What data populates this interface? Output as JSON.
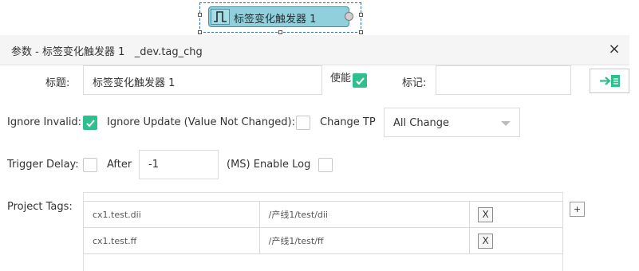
{
  "node": {
    "label": "标签变化触发器 1",
    "icon": "pulse-wave-icon"
  },
  "dialog": {
    "title": "参数 - 标签变化触发器 1   _dev.tag_chg",
    "close_icon": "×"
  },
  "form": {
    "title_label": "标题:",
    "title_value": "标签变化触发器 1",
    "enable_label": "使能",
    "enable_checked": true,
    "mark_label": "标记:",
    "mark_value": "",
    "ignore_invalid_label": "Ignore Invalid:",
    "ignore_invalid_checked": true,
    "ignore_update_label": "Ignore Update (Value Not Changed):",
    "ignore_update_checked": false,
    "change_tp_label": "Change TP",
    "change_tp_value": "All Change",
    "trigger_delay_label": "Trigger Delay:",
    "trigger_delay_checked": false,
    "after_label": "After",
    "after_value": "-1",
    "ms_enable_log_label": "(MS) Enable Log",
    "enable_log_checked": false,
    "project_tags_label": "Project Tags:"
  },
  "tags": [
    {
      "tag": "cx1.test.dii",
      "path": "/产线1/test/dii",
      "remove": "X"
    },
    {
      "tag": "cx1.test.ff",
      "path": "/产线1/test/ff",
      "remove": "X"
    }
  ],
  "add_tag": "+",
  "colors": {
    "accent_green": "#2ebf8c",
    "node_fill": "#8fd0dc"
  }
}
